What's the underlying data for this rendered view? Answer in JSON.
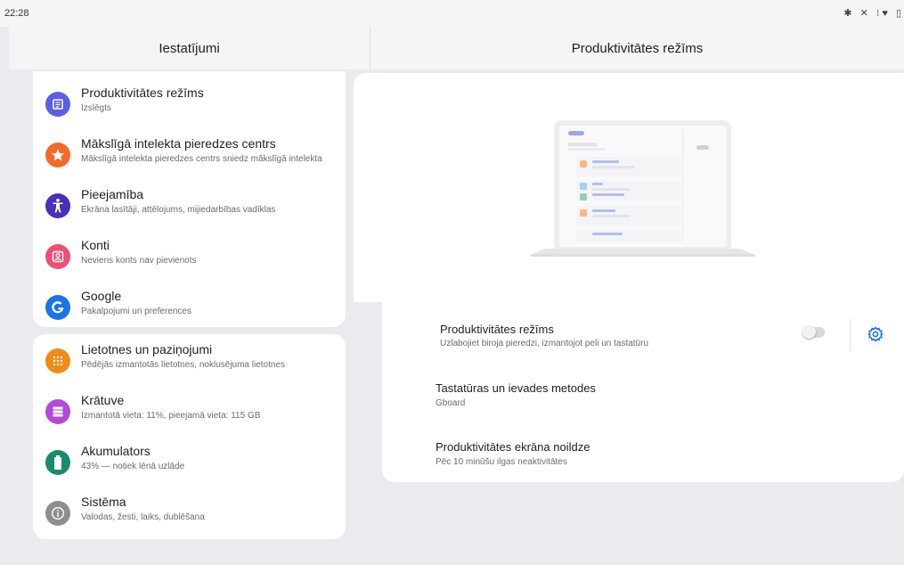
{
  "status": {
    "time": "22:28",
    "icons": "✱ ✕ ⁝♥ ▯"
  },
  "left_title": "Iestatījumi",
  "right_title": "Produktivitātes režīms",
  "groups": [
    [
      {
        "title": "Produktivitātes režīms",
        "subtitle": "Izslēgts",
        "icon": "productivity-icon",
        "color": "#5b5fe6"
      },
      {
        "title": "Mākslīgā intelekta pieredzes centrs",
        "subtitle": "Mākslīgā intelekta pieredzes centrs sniedz mākslīgā intelekta",
        "icon": "star-icon",
        "color": "#f26b2a"
      },
      {
        "title": "Pieejamība",
        "subtitle": "Ekrāna lasītāji, attēlojums, mijiedarbības vadīklas",
        "icon": "accessibility-icon",
        "color": "#4a2fb8"
      },
      {
        "title": "Konti",
        "subtitle": "Neviens konts nav pievienots",
        "icon": "account-icon",
        "color": "#ee4f77"
      },
      {
        "title": "Google",
        "subtitle": "Pakalpojumi un preferences",
        "icon": "google-icon",
        "color": "#1a73e8"
      }
    ],
    [
      {
        "title": "Lietotnes un paziņojumi",
        "subtitle": "Pēdējās izmantotās lietotnes, noklusējuma lietotnes",
        "icon": "apps-icon",
        "color": "#f28a1a"
      },
      {
        "title": "Krātuve",
        "subtitle": "Izmantotā vieta: 11%, pieejamā vieta: 115 GB",
        "icon": "storage-icon",
        "color": "#b14ad6"
      },
      {
        "title": "Akumulators",
        "subtitle": "43% — notiek lēnā uzlāde",
        "icon": "battery-icon",
        "color": "#1a8a6e"
      },
      {
        "title": "Sistēma",
        "subtitle": "Valodas, žesti, laiks, dublēšana",
        "icon": "info-icon",
        "color": "#8e8e8e"
      }
    ]
  ],
  "detail": {
    "rows": [
      {
        "title": "Produktivitātes režīms",
        "subtitle": "Uzlabojiet biroja pieredzi, izmantojot peli un tastatūru",
        "toggle": false
      },
      {
        "title": "Tastatūras un ievades metodes",
        "subtitle": "Gboard"
      },
      {
        "title": "Produktivitātes ekrāna noildze",
        "subtitle": "Pēc 10 minūšu ilgas neaktivitātes"
      }
    ],
    "accent": "#1a73e8"
  }
}
